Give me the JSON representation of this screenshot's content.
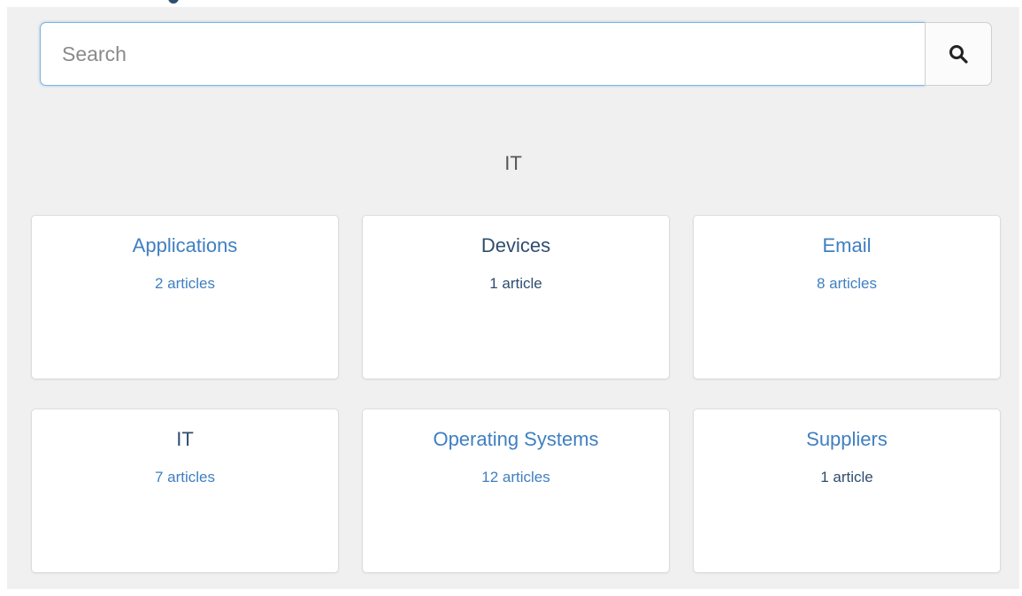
{
  "search": {
    "placeholder": "Search",
    "button_icon": "search-icon"
  },
  "section": {
    "title": "IT"
  },
  "categories": [
    {
      "title": "Applications",
      "count": "2 articles",
      "style": "link"
    },
    {
      "title": "Devices",
      "count": "1 article",
      "style": "dark"
    },
    {
      "title": "Email",
      "count": "8 articles",
      "style": "link"
    },
    {
      "title": "IT",
      "count": "7 articles",
      "style": "dark"
    },
    {
      "title": "Operating Systems",
      "count": "12 articles",
      "style": "link"
    },
    {
      "title": "Suppliers",
      "count": "1 article",
      "style": "dark"
    }
  ],
  "colors": {
    "link": "#3f7fc1",
    "dark": "#2f4d6e",
    "panel_background": "#f0f0f0",
    "card_background": "#ffffff",
    "search_border": "#7fb4e6"
  }
}
